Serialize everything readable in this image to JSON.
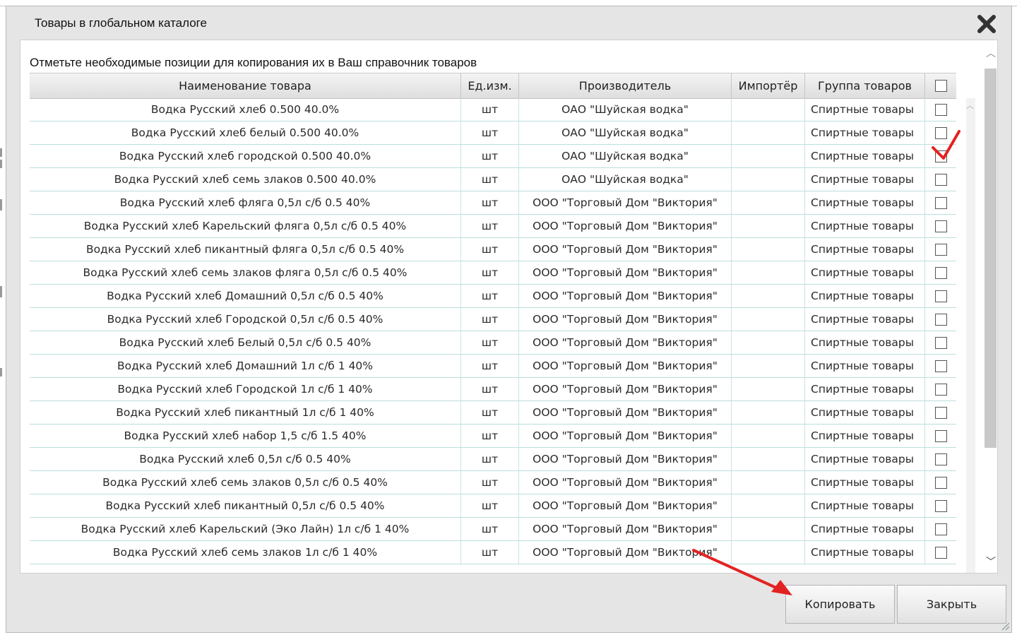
{
  "dialog": {
    "title": "Товары в глобальном каталоге",
    "hint": "Отметьте необходимые позиции для копирования их в Ваш справочник товаров",
    "copy_label": "Копировать",
    "close_label": "Закрыть"
  },
  "table": {
    "columns": [
      "Наименование товара",
      "Ед.изм.",
      "Производитель",
      "Импортёр",
      "Группа товаров"
    ],
    "rows": [
      {
        "name": "Водка Русский хлеб 0.500 40.0%",
        "unit": "шт",
        "mfr": "ОАО \"Шуйская водка\"",
        "imp": "",
        "grp": "Спиртные товары",
        "checked": false
      },
      {
        "name": "Водка Русский хлеб белый 0.500 40.0%",
        "unit": "шт",
        "mfr": "ОАО \"Шуйская водка\"",
        "imp": "",
        "grp": "Спиртные товары",
        "checked": false
      },
      {
        "name": "Водка Русский хлеб городской 0.500 40.0%",
        "unit": "шт",
        "mfr": "ОАО \"Шуйская водка\"",
        "imp": "",
        "grp": "Спиртные товары",
        "checked": true
      },
      {
        "name": "Водка Русский хлеб семь злаков 0.500 40.0%",
        "unit": "шт",
        "mfr": "ОАО \"Шуйская водка\"",
        "imp": "",
        "grp": "Спиртные товары",
        "checked": false
      },
      {
        "name": "Водка Русский хлеб фляга 0,5л с/б 0.5 40%",
        "unit": "шт",
        "mfr": "ООО \"Торговый Дом \"Виктория\"",
        "imp": "",
        "grp": "Спиртные товары",
        "checked": false
      },
      {
        "name": "Водка Русский хлеб Карельский фляга 0,5л с/б 0.5 40%",
        "unit": "шт",
        "mfr": "ООО \"Торговый Дом \"Виктория\"",
        "imp": "",
        "grp": "Спиртные товары",
        "checked": false
      },
      {
        "name": "Водка Русский хлеб пикантный фляга 0,5л с/б 0.5 40%",
        "unit": "шт",
        "mfr": "ООО \"Торговый Дом \"Виктория\"",
        "imp": "",
        "grp": "Спиртные товары",
        "checked": false
      },
      {
        "name": "Водка Русский хлеб семь злаков фляга 0,5л с/б 0.5 40%",
        "unit": "шт",
        "mfr": "ООО \"Торговый Дом \"Виктория\"",
        "imp": "",
        "grp": "Спиртные товары",
        "checked": false
      },
      {
        "name": "Водка Русский хлеб Домашний 0,5л с/б 0.5 40%",
        "unit": "шт",
        "mfr": "ООО \"Торговый Дом \"Виктория\"",
        "imp": "",
        "grp": "Спиртные товары",
        "checked": false
      },
      {
        "name": "Водка Русский хлеб Городской 0,5л с/б 0.5 40%",
        "unit": "шт",
        "mfr": "ООО \"Торговый Дом \"Виктория\"",
        "imp": "",
        "grp": "Спиртные товары",
        "checked": false
      },
      {
        "name": "Водка Русский хлеб Белый 0,5л с/б 0.5 40%",
        "unit": "шт",
        "mfr": "ООО \"Торговый Дом \"Виктория\"",
        "imp": "",
        "grp": "Спиртные товары",
        "checked": false
      },
      {
        "name": "Водка Русский хлеб Домашний 1л с/б 1 40%",
        "unit": "шт",
        "mfr": "ООО \"Торговый Дом \"Виктория\"",
        "imp": "",
        "grp": "Спиртные товары",
        "checked": false
      },
      {
        "name": "Водка Русский хлеб Городской 1л с/б 1 40%",
        "unit": "шт",
        "mfr": "ООО \"Торговый Дом \"Виктория\"",
        "imp": "",
        "grp": "Спиртные товары",
        "checked": false
      },
      {
        "name": "Водка Русский хлеб пикантный 1л с/б 1 40%",
        "unit": "шт",
        "mfr": "ООО \"Торговый Дом \"Виктория\"",
        "imp": "",
        "grp": "Спиртные товары",
        "checked": false
      },
      {
        "name": "Водка Русский хлеб набор 1,5 с/б 1.5 40%",
        "unit": "шт",
        "mfr": "ООО \"Торговый Дом \"Виктория\"",
        "imp": "",
        "grp": "Спиртные товары",
        "checked": false
      },
      {
        "name": "Водка Русский хлеб 0,5л с/б 0.5 40%",
        "unit": "шт",
        "mfr": "ООО \"Торговый Дом \"Виктория\"",
        "imp": "",
        "grp": "Спиртные товары",
        "checked": false
      },
      {
        "name": "Водка Русский хлеб семь злаков 0,5л с/б 0.5 40%",
        "unit": "шт",
        "mfr": "ООО \"Торговый Дом \"Виктория\"",
        "imp": "",
        "grp": "Спиртные товары",
        "checked": false
      },
      {
        "name": "Водка Русский хлеб пикантный 0,5л с/б 0.5 40%",
        "unit": "шт",
        "mfr": "ООО \"Торговый Дом \"Виктория\"",
        "imp": "",
        "grp": "Спиртные товары",
        "checked": false
      },
      {
        "name": "Водка Русский хлеб Карельский (Эко Лайн) 1л с/б 1 40%",
        "unit": "шт",
        "mfr": "ООО \"Торговый Дом \"Виктория\"",
        "imp": "",
        "grp": "Спиртные товары",
        "checked": false
      },
      {
        "name": "Водка Русский хлеб семь злаков 1л с/б 1 40%",
        "unit": "шт",
        "mfr": "ООО \"Торговый Дом \"Виктория\"",
        "imp": "",
        "grp": "Спиртные товары",
        "checked": false
      }
    ]
  },
  "colors": {
    "annotation": "#e32222",
    "row_border": "#b9dfdc"
  },
  "icons": {
    "close": "close-x-icon",
    "scroll_up": "chevron-up-icon",
    "scroll_down": "chevron-down-icon"
  }
}
